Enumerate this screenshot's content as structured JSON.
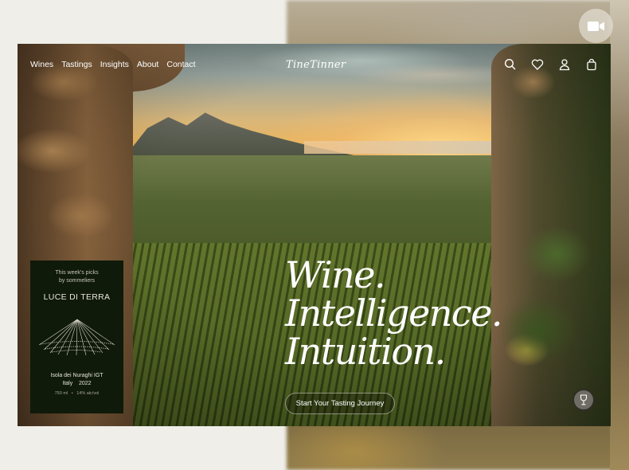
{
  "nav": {
    "items": [
      "Wines",
      "Tastings",
      "Insights",
      "About",
      "Contact"
    ]
  },
  "logo": {
    "text": "TineTinner"
  },
  "header_icons": [
    "search-icon",
    "heart-icon",
    "user-icon",
    "bag-icon"
  ],
  "hero": {
    "headline": [
      "Wine.",
      "Intelligence.",
      "Intuition."
    ],
    "cta_label": "Start Your Tasting Journey"
  },
  "picks": {
    "kicker_line1": "This week's picks",
    "kicker_line2": "by sommeliers",
    "wine_name": "LUCE DI TERRA",
    "region": "Isola dei Nuraghi IGT",
    "country_year": "Italy    2022",
    "details": "750 ml   •   14% alc/vol"
  },
  "colors": {
    "accent_dark": "#0f1a0a",
    "text_light": "#ffffff",
    "backdrop_cream": "#efeee8"
  }
}
